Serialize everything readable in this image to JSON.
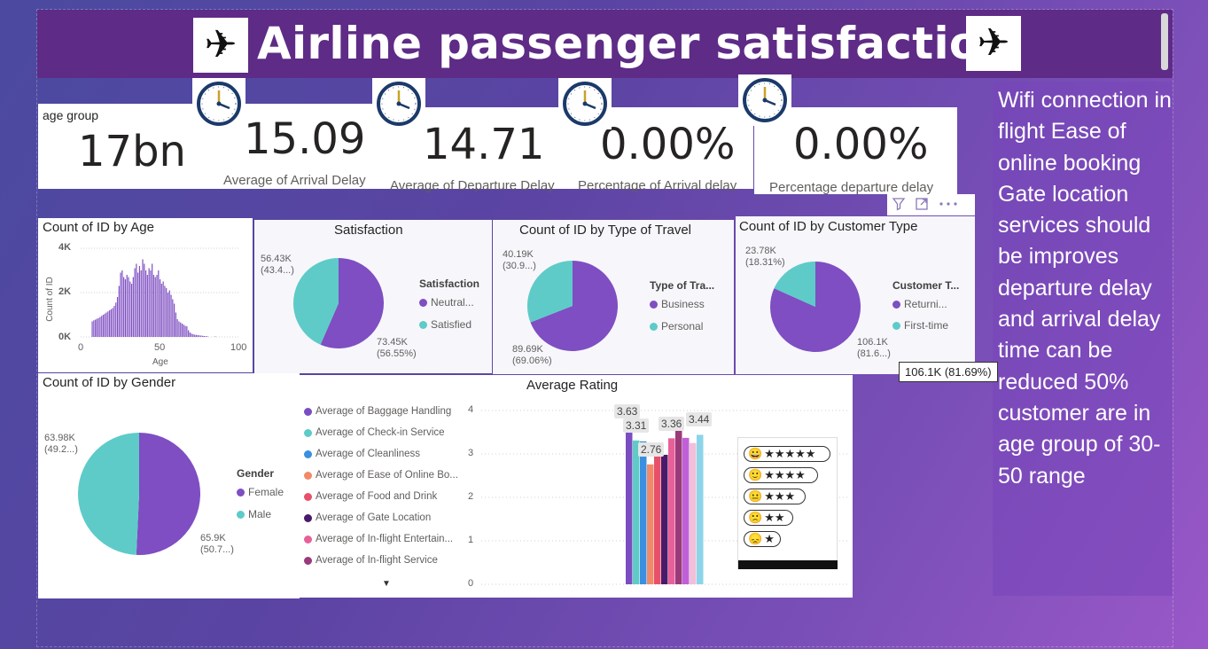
{
  "header": {
    "title": "Airline passenger satisfaction"
  },
  "kpis": [
    {
      "label": "age group",
      "value": "17bn"
    },
    {
      "label": "Average of Arrival Delay",
      "value": "15.09"
    },
    {
      "label": "Average of Departure Delay",
      "value": "14.71"
    },
    {
      "label": "Percentage of Arrival delay",
      "value": "0.00%"
    },
    {
      "label": "Percentage departure delay",
      "value": "0.00%"
    }
  ],
  "age_chart": {
    "title": "Count of ID by Age",
    "xlabel": "Age",
    "ylabel": "Count of ID",
    "y_ticks": [
      "4K",
      "2K",
      "0K"
    ],
    "x_ticks": [
      "0",
      "50",
      "100"
    ]
  },
  "satisfaction": {
    "title": "Satisfaction",
    "legend_title": "Satisfaction",
    "legend": [
      "Neutral...",
      "Satisfied"
    ],
    "label_a": [
      "56.43K",
      "(43.4...)"
    ],
    "label_b": [
      "73.45K",
      "(56.55%)"
    ]
  },
  "travel_type": {
    "title": "Count of ID by Type of Travel",
    "legend_title": "Type of Tra...",
    "legend": [
      "Business",
      "Personal"
    ],
    "label_a": [
      "40.19K",
      "(30.9...)"
    ],
    "label_b": [
      "89.69K",
      "(69.06%)"
    ]
  },
  "customer_type": {
    "title": "Count of ID by Customer Type",
    "legend_title": "Customer T...",
    "legend": [
      "Returni...",
      "First-time"
    ],
    "label_a": [
      "23.78K",
      "(18.31%)"
    ],
    "label_b": [
      "106.1K",
      "(81.6...)"
    ],
    "tooltip": "106.1K (81.69%)"
  },
  "gender": {
    "title": "Count of ID by Gender",
    "legend_title": "Gender",
    "legend": [
      "Female",
      "Male"
    ],
    "label_a": [
      "63.98K",
      "(49.2...)"
    ],
    "label_b": [
      "65.9K",
      "(50.7...)"
    ]
  },
  "rating": {
    "title": "Average Rating",
    "legend": [
      "Average of Baggage Handling",
      "Average of Check-in Service",
      "Average of Cleanliness",
      "Average of Ease of Online Bo...",
      "Average of Food and Drink",
      "Average of Gate Location",
      "Average of In-flight Entertain...",
      "Average of In-flight Service"
    ],
    "y_ticks": [
      "4",
      "3",
      "2",
      "1",
      "0"
    ],
    "bar_labels": [
      "3.63",
      "3.31",
      "2.76",
      "3.36",
      "3.44"
    ]
  },
  "notes": {
    "text": "Wifi connection in flight Ease of online booking Gate location services should be improves departure delay and arrival delay time can be reduced 50% customer are in age group of 30-50 range"
  },
  "colors": {
    "purple": "#7e4ec2",
    "teal": "#5ecbc8",
    "banner": "#5e2b86"
  },
  "chart_data": [
    {
      "type": "bar",
      "title": "Count of ID by Age",
      "xlabel": "Age",
      "ylabel": "Count of ID",
      "ylim": [
        0,
        4000
      ],
      "xlim": [
        0,
        100
      ],
      "x": [
        7,
        8,
        9,
        10,
        11,
        12,
        13,
        14,
        15,
        16,
        17,
        18,
        19,
        20,
        21,
        22,
        23,
        24,
        25,
        26,
        27,
        28,
        29,
        30,
        31,
        32,
        33,
        34,
        35,
        36,
        37,
        38,
        39,
        40,
        41,
        42,
        43,
        44,
        45,
        46,
        47,
        48,
        49,
        50,
        51,
        52,
        53,
        54,
        55,
        56,
        57,
        58,
        59,
        60,
        61,
        62,
        63,
        64,
        65,
        66,
        67,
        68,
        69,
        70,
        71,
        72,
        73,
        74,
        75,
        76,
        77,
        78,
        79,
        80,
        85
      ],
      "values": [
        700,
        750,
        780,
        820,
        850,
        900,
        950,
        1000,
        1050,
        1100,
        1150,
        1200,
        1250,
        1300,
        1400,
        1550,
        1800,
        2300,
        2900,
        3000,
        2700,
        2600,
        2800,
        2700,
        2500,
        2400,
        2700,
        3100,
        3300,
        2900,
        3200,
        3000,
        3500,
        3300,
        3000,
        2800,
        3100,
        3000,
        3300,
        2800,
        2700,
        2800,
        3000,
        2600,
        2400,
        2500,
        2300,
        2200,
        2000,
        2100,
        1900,
        1700,
        1500,
        1100,
        800,
        700,
        650,
        600,
        550,
        500,
        480,
        300,
        200,
        150,
        120,
        100,
        90,
        80,
        70,
        60,
        50,
        40,
        35,
        30,
        20
      ]
    },
    {
      "type": "pie",
      "title": "Satisfaction",
      "categories": [
        "Neutral...",
        "Satisfied"
      ],
      "values": [
        73450,
        56430
      ],
      "percents": [
        56.55,
        43.45
      ]
    },
    {
      "type": "pie",
      "title": "Count of ID by Type of Travel",
      "categories": [
        "Business",
        "Personal"
      ],
      "values": [
        89690,
        40190
      ],
      "percents": [
        69.06,
        30.94
      ]
    },
    {
      "type": "pie",
      "title": "Count of ID by Customer Type",
      "categories": [
        "Returni...",
        "First-time"
      ],
      "values": [
        106100,
        23780
      ],
      "percents": [
        81.69,
        18.31
      ]
    },
    {
      "type": "pie",
      "title": "Count of ID by Gender",
      "categories": [
        "Female",
        "Male"
      ],
      "values": [
        65900,
        63980
      ],
      "percents": [
        50.74,
        49.26
      ]
    },
    {
      "type": "bar",
      "title": "Average Rating",
      "ylim": [
        0,
        4
      ],
      "series": [
        {
          "name": "Average of Baggage Handling",
          "color": "#7a4ec0",
          "values": [
            3.63
          ]
        },
        {
          "name": "Average of Check-in Service",
          "color": "#5ecbc8",
          "values": [
            3.31
          ]
        },
        {
          "name": "Average of Cleanliness",
          "color": "#3a8fe0",
          "values": [
            3.29
          ]
        },
        {
          "name": "Average of Ease of Online Bo...",
          "color": "#f28a6a",
          "values": [
            2.76
          ]
        },
        {
          "name": "Average of Food and Drink",
          "color": "#e8506a",
          "values": [
            3.21
          ]
        },
        {
          "name": "Average of Gate Location",
          "color": "#4a1a6a",
          "values": [
            2.98
          ]
        },
        {
          "name": "Average of In-flight Entertain...",
          "color": "#e8609a",
          "values": [
            3.36
          ]
        },
        {
          "name": "Average of In-flight Service",
          "color": "#9a3a7a",
          "values": [
            3.64
          ]
        },
        {
          "name": "",
          "color": "#c060d8",
          "values": [
            3.37
          ]
        },
        {
          "name": "",
          "color": "#f0c0d8",
          "values": [
            3.25
          ]
        },
        {
          "name": "",
          "color": "#8cd4e8",
          "values": [
            3.44
          ]
        }
      ]
    }
  ]
}
